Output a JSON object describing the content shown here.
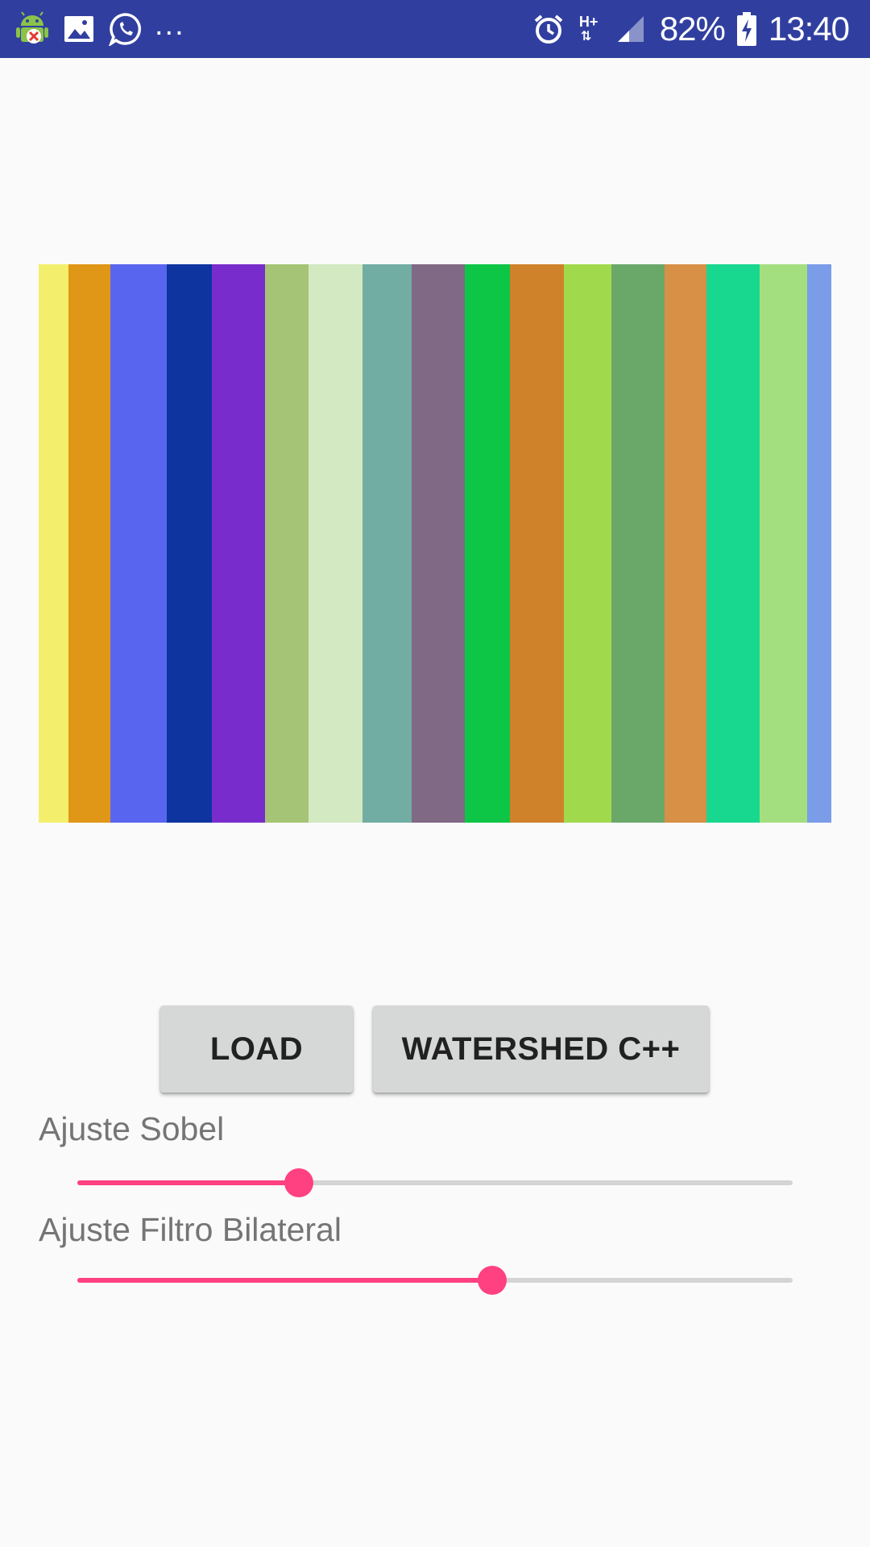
{
  "status_bar": {
    "battery": "82%",
    "time": "13:40",
    "network": "H+",
    "overflow": "...",
    "background": "#303f9f",
    "left_icons": [
      "android-debug-icon",
      "image-icon",
      "whatsapp-icon"
    ],
    "right_icons": [
      "alarm-icon",
      "network-type-icon",
      "signal-icon",
      "battery-charging-icon"
    ]
  },
  "image_view": {
    "stripes": [
      {
        "color": "#f3ef6c",
        "weight": 3.7
      },
      {
        "color": "#e09616",
        "weight": 5.2
      },
      {
        "color": "#5866ef",
        "weight": 7.0
      },
      {
        "color": "#0e34a0",
        "weight": 5.6
      },
      {
        "color": "#792ccc",
        "weight": 6.7
      },
      {
        "color": "#a5c475",
        "weight": 5.4
      },
      {
        "color": "#d3e9c1",
        "weight": 6.7
      },
      {
        "color": "#72ada4",
        "weight": 6.1
      },
      {
        "color": "#806984",
        "weight": 6.6
      },
      {
        "color": "#0ec646",
        "weight": 5.6
      },
      {
        "color": "#cf822a",
        "weight": 6.7
      },
      {
        "color": "#a1d94d",
        "weight": 5.9
      },
      {
        "color": "#6aa86a",
        "weight": 6.7
      },
      {
        "color": "#d88f46",
        "weight": 5.2
      },
      {
        "color": "#18d78f",
        "weight": 6.6
      },
      {
        "color": "#a4df7f",
        "weight": 5.9
      },
      {
        "color": "#7a9ce9",
        "weight": 3.0
      }
    ]
  },
  "buttons": {
    "load": "LOAD",
    "watershed": "WATERSHED C++"
  },
  "controls": {
    "sobel_label": "Ajuste Sobel",
    "sobel_value": 0.31,
    "bilateral_label": "Ajuste Filtro Bilateral",
    "bilateral_value": 0.58,
    "accent_color": "#ff4081"
  }
}
